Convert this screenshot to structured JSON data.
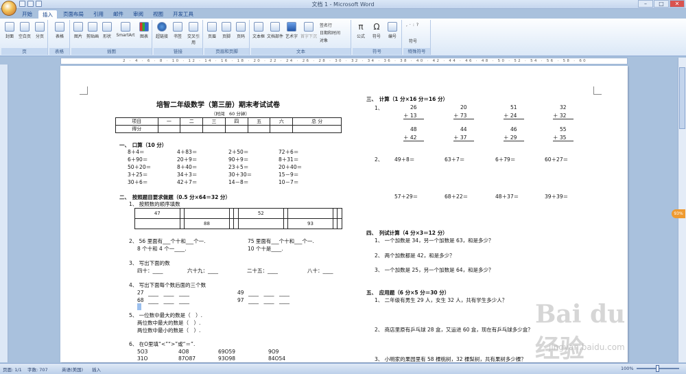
{
  "window": {
    "title": "文档 1 - Microsoft Word",
    "controls": [
      "–",
      "□",
      "✕"
    ]
  },
  "tabs": [
    "开始",
    "插入",
    "页面布局",
    "引用",
    "邮件",
    "审阅",
    "视图",
    "开发工具"
  ],
  "active_tab": "插入",
  "ribbon": {
    "groups": [
      {
        "label": "页",
        "buttons": [
          "封面",
          "空白页",
          "分页"
        ]
      },
      {
        "label": "表格",
        "buttons": [
          "表格"
        ]
      },
      {
        "label": "插图",
        "buttons": [
          "图片",
          "剪贴画",
          "形状",
          "SmartArt",
          "图表"
        ]
      },
      {
        "label": "链接",
        "buttons": [
          "超链接",
          "书签",
          "交叉引用"
        ]
      },
      {
        "label": "页眉和页脚",
        "buttons": [
          "页眉",
          "页脚",
          "页码"
        ]
      },
      {
        "label": "文本",
        "buttons": [
          "文本框",
          "文档部件",
          "艺术字",
          "首字下沉"
        ],
        "small": [
          "签名行",
          "日期和时间",
          "对象"
        ]
      },
      {
        "label": "符号",
        "buttons": [
          "公式",
          "符号",
          "编号"
        ]
      },
      {
        "label": "特殊符号",
        "buttons": [
          "符号"
        ]
      }
    ]
  },
  "doc": {
    "title": "培智二年级数学（第三册）期末考试试卷",
    "time": "（时间　60 分钟）",
    "score_table": {
      "headers": [
        "项目",
        "一",
        "二",
        "三",
        "四",
        "五",
        "六",
        "总 分"
      ],
      "row2": "得分"
    },
    "s1": {
      "heading": "一、　口算（10 分）",
      "rows": [
        [
          "8＋4＝",
          "4＋83＝",
          "2＋50＝",
          "72＋6＝"
        ],
        [
          "6＋90＝",
          "20＋9＝",
          "90＋9＝",
          "8＋31＝"
        ],
        [
          "50＋20＝",
          "8＋40＝",
          "23＋5＝",
          "20＋40＝"
        ],
        [
          "3＋25＝",
          "34＋3＝",
          "30＋30＝",
          "15－9＝"
        ],
        [
          "30＋6＝",
          "42＋7＝",
          "14－8＝",
          "10－7＝"
        ]
      ]
    },
    "s2": {
      "heading": "二、　按照题目要求做题（0.5 分×64＝32 分）",
      "q1": "1、 按照数的顺序填数",
      "grid_row1": [
        "47",
        "",
        "",
        "",
        "",
        "52",
        "",
        "",
        "",
        ""
      ],
      "grid_row2": [
        "",
        "",
        "88",
        "",
        "",
        "",
        "",
        "93",
        "",
        ""
      ],
      "q2a": "2、 56 里面有___个十和___个一.",
      "q2b": "75 里面有___个十和___个一.",
      "q2c": "8 个十和 4 个一____.",
      "q2d": "10 个十是____.",
      "q3": "3、 写出下面的数",
      "q3row": [
        "四十：____",
        "六十九：____",
        "二十五：____",
        "八十：____"
      ],
      "q4": "4、 写出下面每个数后面的三个数",
      "q4rows": [
        [
          "27",
          "49"
        ],
        [
          "68",
          "97"
        ]
      ],
      "q4blank": "____　____　____",
      "q5": "5、 一位数中最大的数是（　）.",
      "q5b": "两位数中最大的数是（　）.",
      "q5c": "两位数中最小的数是（　）.",
      "q6": "6、 在O里填“<”“>”或“＝”.",
      "q6rows": [
        [
          "5O3",
          "4O8",
          "69O59",
          "9O9"
        ],
        [
          "31O",
          "87O87",
          "93O98",
          "84O54"
        ]
      ]
    },
    "s3": {
      "heading": "三、　计算（1 分×16 分＝16 分）",
      "n1": "1、",
      "vertical": [
        [
          "26",
          "＋ 13"
        ],
        [
          "20",
          "＋ 73"
        ],
        [
          "51",
          "＋ 24"
        ],
        [
          "32",
          "＋ 32"
        ],
        [
          "48",
          "＋ 42"
        ],
        [
          "44",
          "＋ 37"
        ],
        [
          "46",
          "＋ 29"
        ],
        [
          "55",
          "＋ 35"
        ]
      ],
      "n2": "2、",
      "row1": [
        "49＋8＝",
        "63＋7＝",
        "6＋79＝",
        "60＋27＝"
      ],
      "row2": [
        "57＋29＝",
        "68＋22＝",
        "48＋37＝",
        "39＋39＝"
      ]
    },
    "s4": {
      "heading": "四、　列试计算（4 分×3＝12 分）",
      "items": [
        "1、 一个加数是 34，另一个加数是 63，和是多少？",
        "2、 两个加数都是 42，和是多少？",
        "3、 一个加数是 25，另一个加数是 64，和是多少？"
      ]
    },
    "s5": {
      "heading": "五、　应用题（6 分×5 分＝30 分）",
      "items": [
        "1、 二年级有男生 29 人，女生 32 人，共有学生多少人？",
        "2、 商店里原有乒乓球 28 盒，又运进 60 盒，现在有乒乓球多少盒？",
        "3、 小明家的果园里有 58 棵桃树，32 棵梨树，共有果树多少棵？"
      ]
    }
  },
  "status": {
    "page": "页面: 1/1",
    "words": "字数: 707",
    "lang": "英语(美国)",
    "mode": "插入",
    "zoom": "100%"
  },
  "watermark": {
    "logo": "Bai du 经验",
    "url": "jingyan.baidu.com"
  },
  "side_badge": "93%"
}
